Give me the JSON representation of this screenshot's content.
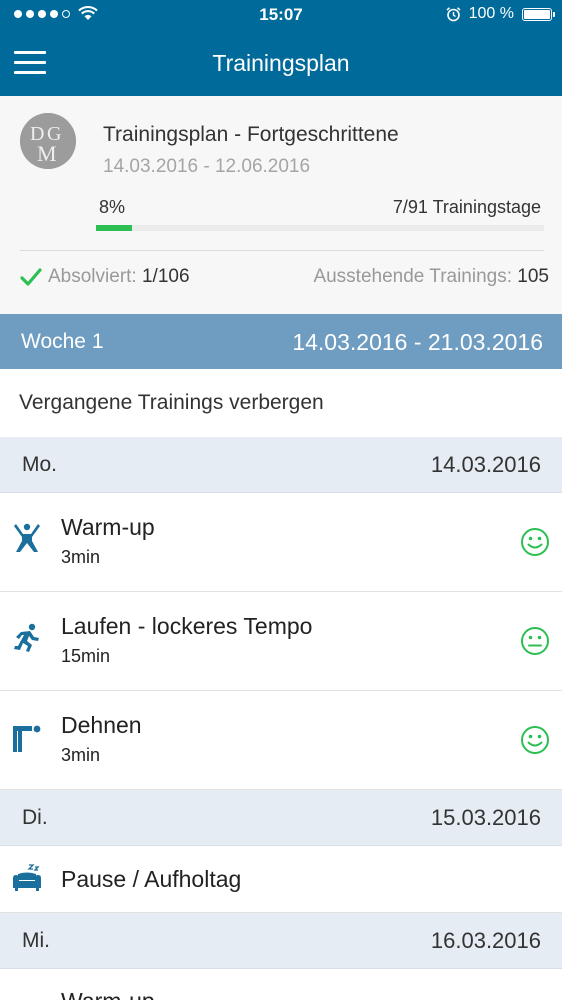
{
  "status": {
    "time": "15:07",
    "battery": "100 %"
  },
  "nav": {
    "title": "Trainingsplan"
  },
  "plan": {
    "avatar_text": "DGM",
    "title": "Trainingsplan - Fortgeschrittene",
    "dates": "14.03.2016 - 12.06.2016",
    "progress_label": "8%",
    "progress_fraction": 0.08,
    "days_label": "7/91 Trainingstage",
    "done_label": "Absolviert:",
    "done_value": "1/106",
    "pending_label": "Ausstehende Trainings:",
    "pending_value": "105"
  },
  "week": {
    "label": "Woche 1",
    "range": "14.03.2016 - 21.03.2016"
  },
  "hide_past": "Vergangene Trainings verbergen",
  "days": [
    {
      "day": "Mo.",
      "date": "14.03.2016"
    },
    {
      "day": "Di.",
      "date": "15.03.2016"
    },
    {
      "day": "Mi.",
      "date": "16.03.2016"
    }
  ],
  "trainings": [
    {
      "title": "Warm-up",
      "duration": "3min",
      "icon": "warmup-icon",
      "mood": "happy"
    },
    {
      "title": "Laufen - lockeres Tempo",
      "duration": "15min",
      "icon": "running-icon",
      "mood": "neutral"
    },
    {
      "title": "Dehnen",
      "duration": "3min",
      "icon": "stretching-icon",
      "mood": "happy"
    },
    {
      "title": "Pause / Aufholtag",
      "icon": "rest-icon"
    },
    {
      "title": "Warm-up",
      "icon": "warmup-icon"
    }
  ],
  "colors": {
    "primary": "#006b9a",
    "week_bar": "#6e9dc1",
    "day_bar": "#e6ecf3",
    "success": "#2dbf52",
    "icon": "#1a6f9c"
  }
}
